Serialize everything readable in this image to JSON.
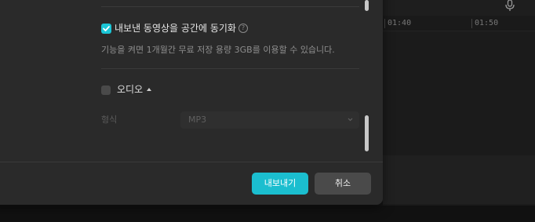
{
  "timeline": {
    "ruler_ticks": [
      "01:40",
      "01:50"
    ]
  },
  "dialog": {
    "sync": {
      "label": "내보낸 동영상을 공간에 동기화",
      "checked": true,
      "help_glyph": "?",
      "description": "기능을 켜면 1개월간 무료 저장 용량 3GB를 이용할 수 있습니다."
    },
    "audio": {
      "label": "오디오",
      "checked": false,
      "format_label": "형식",
      "format_value": "MP3"
    },
    "buttons": {
      "export_label": "내보내기",
      "cancel_label": "취소"
    }
  },
  "colors": {
    "accent": "#1bc6d6",
    "dialog_bg": "#2a2a2a",
    "cancel_bg": "#4a4a4a"
  },
  "icons": [
    "mic-icon",
    "check-icon",
    "help-icon",
    "caret-up-icon",
    "chevron-down-icon"
  ]
}
